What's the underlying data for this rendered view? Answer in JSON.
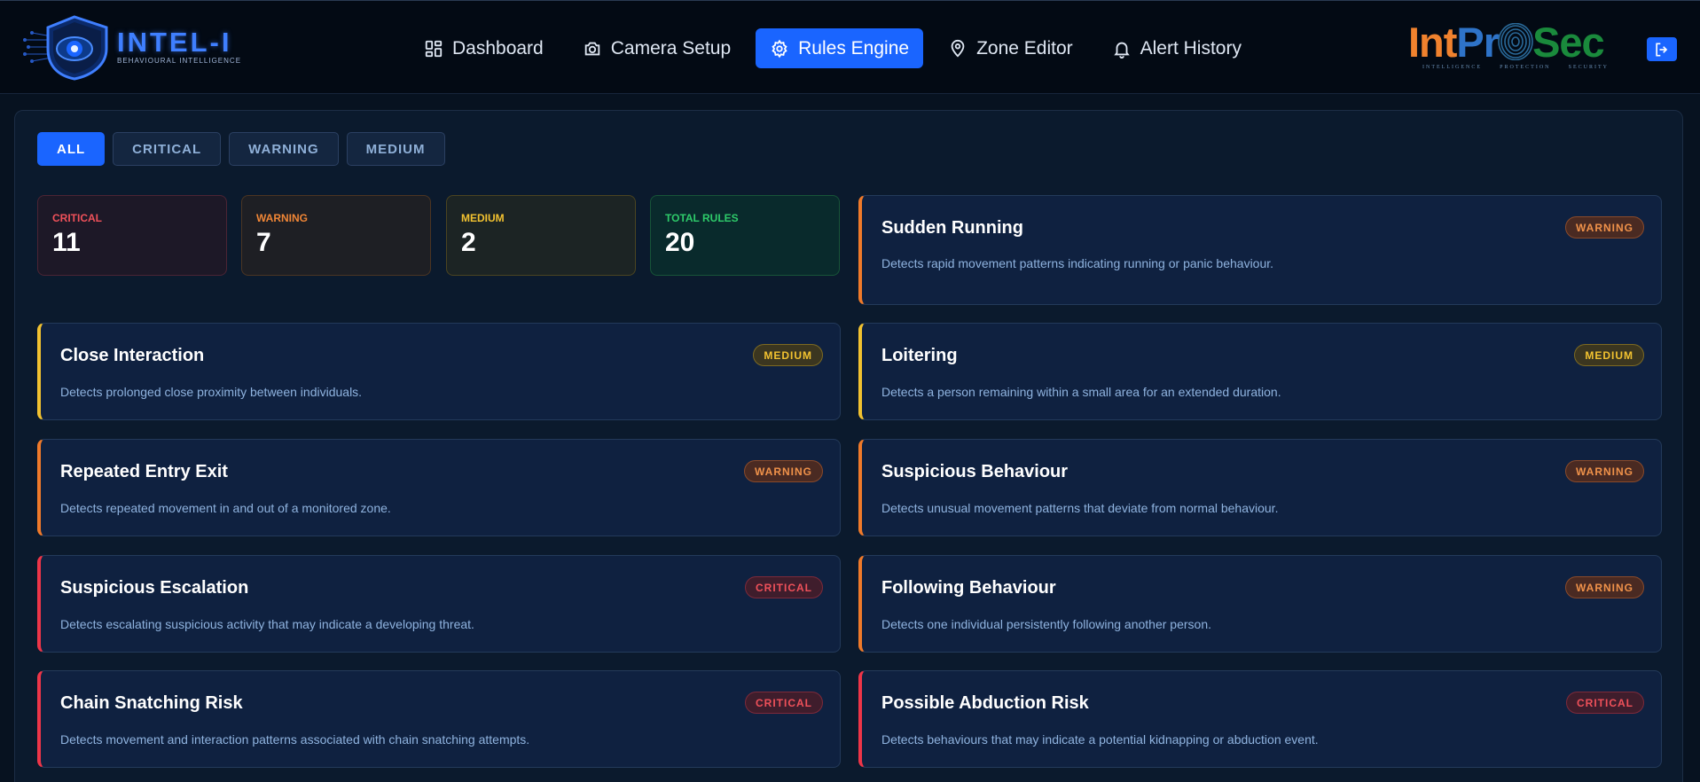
{
  "header": {
    "brand_name": "INTEL-I",
    "brand_subtitle": "BEHAVIOURAL INTELLIGENCE",
    "nav": [
      {
        "label": "Dashboard",
        "icon": "grid-icon"
      },
      {
        "label": "Camera Setup",
        "icon": "camera-icon"
      },
      {
        "label": "Rules Engine",
        "icon": "gear-icon",
        "active": true
      },
      {
        "label": "Zone Editor",
        "icon": "map-pin-icon"
      },
      {
        "label": "Alert History",
        "icon": "bell-icon"
      }
    ],
    "partner": {
      "name_part1": "Int",
      "name_part2": "Pr",
      "name_part3": "Sec",
      "tags": [
        "INTELLIGENCE",
        "PROTECTION",
        "SECURITY"
      ]
    },
    "logout_icon": "logout-icon"
  },
  "filters": [
    "ALL",
    "CRITICAL",
    "WARNING",
    "MEDIUM"
  ],
  "active_filter": "ALL",
  "stats": [
    {
      "label": "CRITICAL",
      "value": "11"
    },
    {
      "label": "WARNING",
      "value": "7"
    },
    {
      "label": "MEDIUM",
      "value": "2"
    },
    {
      "label": "TOTAL RULES",
      "value": "20"
    }
  ],
  "rules": [
    {
      "title": "Sudden Running",
      "severity": "WARNING",
      "description": "Detects rapid movement patterns indicating running or panic behaviour."
    },
    {
      "title": "Close Interaction",
      "severity": "MEDIUM",
      "description": "Detects prolonged close proximity between individuals."
    },
    {
      "title": "Loitering",
      "severity": "MEDIUM",
      "description": "Detects a person remaining within a small area for an extended duration."
    },
    {
      "title": "Repeated Entry Exit",
      "severity": "WARNING",
      "description": "Detects repeated movement in and out of a monitored zone."
    },
    {
      "title": "Suspicious Behaviour",
      "severity": "WARNING",
      "description": "Detects unusual movement patterns that deviate from normal behaviour."
    },
    {
      "title": "Suspicious Escalation",
      "severity": "CRITICAL",
      "description": "Detects escalating suspicious activity that may indicate a developing threat."
    },
    {
      "title": "Following Behaviour",
      "severity": "WARNING",
      "description": "Detects one individual persistently following another person."
    },
    {
      "title": "Chain Snatching Risk",
      "severity": "CRITICAL",
      "description": "Detects movement and interaction patterns associated with chain snatching attempts."
    },
    {
      "title": "Possible Abduction Risk",
      "severity": "CRITICAL",
      "description": "Detects behaviours that may indicate a potential kidnapping or abduction event."
    }
  ],
  "colors": {
    "accent": "#1a65ff",
    "critical": "#ee3548",
    "warning": "#f07a2a",
    "medium": "#f2c230",
    "total": "#2ecb6a"
  }
}
